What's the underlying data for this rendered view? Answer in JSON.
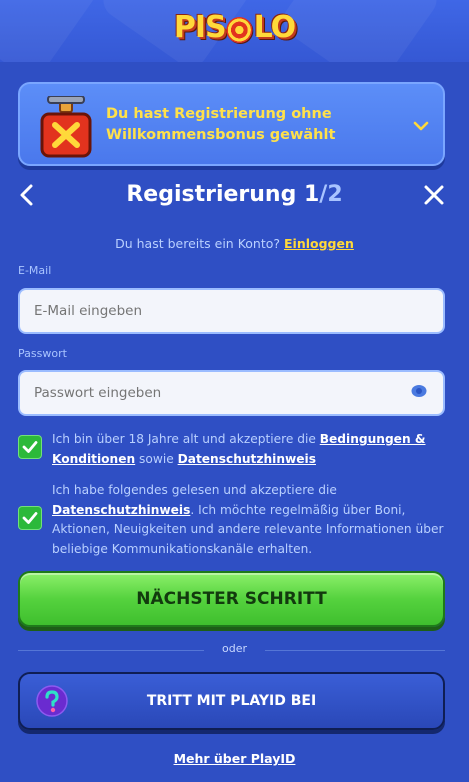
{
  "brand": {
    "logo_text_left": "PIS",
    "logo_text_right": "LO",
    "logo_word": "PISTOLO"
  },
  "bonus_banner": {
    "text": "Du hast Registrierung ohne Willkommensbonus gewählt",
    "icon": "bonus-tnt-icon",
    "toggle_icon": "chevron-down-icon"
  },
  "header": {
    "title_prefix": "Registrierung ",
    "step_current": "1",
    "step_sep": "/",
    "step_total": "2",
    "back_icon": "chevron-left-icon",
    "close_icon": "close-icon"
  },
  "login_prompt": {
    "text": "Du hast bereits ein Konto?",
    "link": "Einloggen"
  },
  "form": {
    "email": {
      "label": "E-Mail",
      "placeholder": "E-Mail eingeben",
      "value": ""
    },
    "password": {
      "label": "Passwort",
      "placeholder": "Passwort eingeben",
      "value": "",
      "toggle_icon": "eye-icon"
    }
  },
  "checks": [
    {
      "checked": true,
      "text_a": "Ich bin über 18 Jahre alt und akzeptiere die ",
      "link_a": "Bedingungen & Konditionen",
      "text_b": " sowie ",
      "link_b": "Datenschutzhinweis"
    },
    {
      "checked": true,
      "text_a": "Ich habe folgendes gelesen und akzeptiere die ",
      "link_a": "Datenschutzhinweis",
      "text_b": ". Ich möchte regelmäßig über Boni, Aktionen, Neuigkeiten und andere relevante Informationen über beliebige Kommunikationskanäle erhalten."
    }
  ],
  "actions": {
    "next_label": "NÄCHSTER SCHRITT",
    "separator": "oder",
    "playid_label": "TRITT MIT PLAYID BEI",
    "playid_icon": "playid-icon",
    "more_link": "Mehr über PlayID"
  },
  "colors": {
    "background": "#2f4fc4",
    "accent_yellow": "#ffd93a",
    "primary_green": "#55d23e",
    "banner_blue": "#5c8ef8"
  }
}
